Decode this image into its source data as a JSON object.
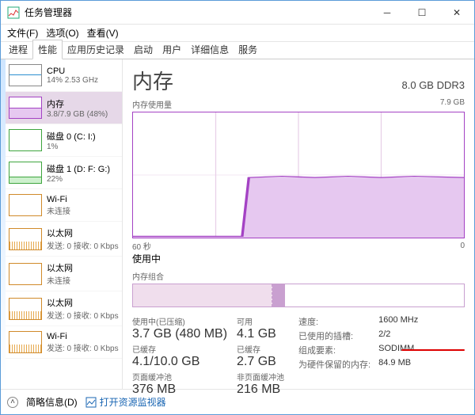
{
  "window": {
    "title": "任务管理器"
  },
  "menu": {
    "file": "文件(F)",
    "options": "选项(O)",
    "view": "查看(V)"
  },
  "tabs": [
    "进程",
    "性能",
    "应用历史记录",
    "启动",
    "用户",
    "详细信息",
    "服务"
  ],
  "active_tab_index": 1,
  "sidebar": {
    "items": [
      {
        "name": "CPU",
        "sub": "14% 2.53 GHz"
      },
      {
        "name": "内存",
        "sub": "3.8/7.9 GB (48%)"
      },
      {
        "name": "磁盘 0 (C: I:)",
        "sub": "1%"
      },
      {
        "name": "磁盘 1 (D: F: G:)",
        "sub": "22%"
      },
      {
        "name": "Wi-Fi",
        "sub": "未连接"
      },
      {
        "name": "以太网",
        "sub": "发送: 0 接收: 0 Kbps"
      },
      {
        "name": "以太网",
        "sub": "未连接"
      },
      {
        "name": "以太网",
        "sub": "发送: 0 接收: 0 Kbps"
      },
      {
        "name": "Wi-Fi",
        "sub": "发送: 0 接收: 0 Kbps"
      }
    ],
    "selected_index": 1
  },
  "main": {
    "title": "内存",
    "spec": "8.0 GB DDR3",
    "usage_label": "内存使用量",
    "usage_max": "7.9 GB",
    "x_left": "60 秒",
    "x_right": "0",
    "inuse_marker": "使用中",
    "composition_label": "内存组合"
  },
  "stats": {
    "used_label": "使用中(已压缩)",
    "used_value": "3.7 GB (480 MB)",
    "avail_label": "可用",
    "avail_value": "4.1 GB",
    "commit_label": "已缓存",
    "commit_value": "4.1/10.0 GB",
    "cached_label": "已缓存",
    "cached_value": "2.7 GB",
    "paged_label": "页面缓冲池",
    "paged_value": "376 MB",
    "nonpaged_label": "非页面缓冲池",
    "nonpaged_value": "216 MB"
  },
  "right_stats": {
    "speed_label": "速度:",
    "speed_value": "1600 MHz",
    "slots_label": "已使用的插槽:",
    "slots_value": "2/2",
    "form_label": "组成要素:",
    "form_value": "SODIMM",
    "hw_label": "为硬件保留的内存:",
    "hw_value": "84.9 MB"
  },
  "footer": {
    "less": "简略信息(D)",
    "link": "打开资源监视器"
  },
  "chart_data": {
    "type": "area",
    "title": "内存使用量",
    "xlabel": "seconds ago",
    "ylabel": "GB",
    "ylim": [
      0,
      7.9
    ],
    "xlim_seconds": [
      60,
      0
    ],
    "series": [
      {
        "name": "使用中",
        "x_seconds_ago": [
          60,
          45,
          40,
          39,
          38,
          30,
          20,
          10,
          0
        ],
        "y_gb": [
          0.05,
          0.05,
          0.05,
          3.8,
          3.8,
          3.85,
          3.8,
          3.85,
          3.8
        ]
      }
    ]
  }
}
